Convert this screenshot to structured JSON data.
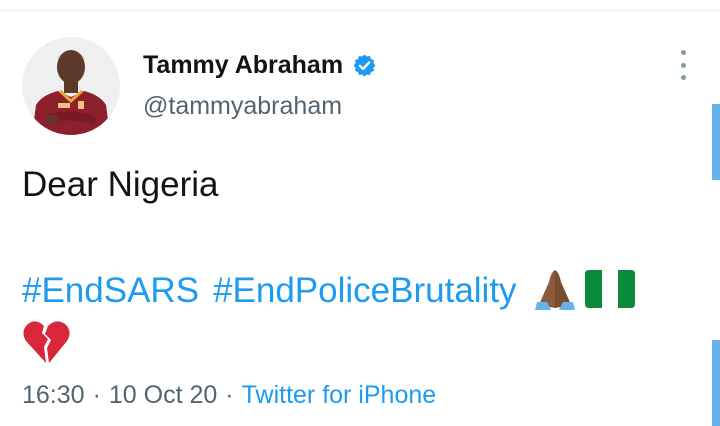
{
  "tweet": {
    "author": {
      "display_name": "Tammy Abraham",
      "handle": "@tammyabraham",
      "verified": true
    },
    "text_line1": "Dear Nigeria",
    "hashtags": [
      "#EndSARS",
      "#EndPoliceBrutality"
    ],
    "emojis": [
      "folded-hands-dark-skin",
      "nigeria-flag",
      "broken-heart"
    ],
    "timestamp_time": "16:30",
    "timestamp_date": "10 Oct 20",
    "separator": "·",
    "source": "Twitter for iPhone"
  },
  "colors": {
    "link": "#1d9bf0",
    "text": "#0f1419",
    "secondary": "#536471",
    "verified": "#1d9bf0"
  },
  "icons": {
    "more": "more-vertical-icon",
    "verified": "verified-badge-icon"
  }
}
